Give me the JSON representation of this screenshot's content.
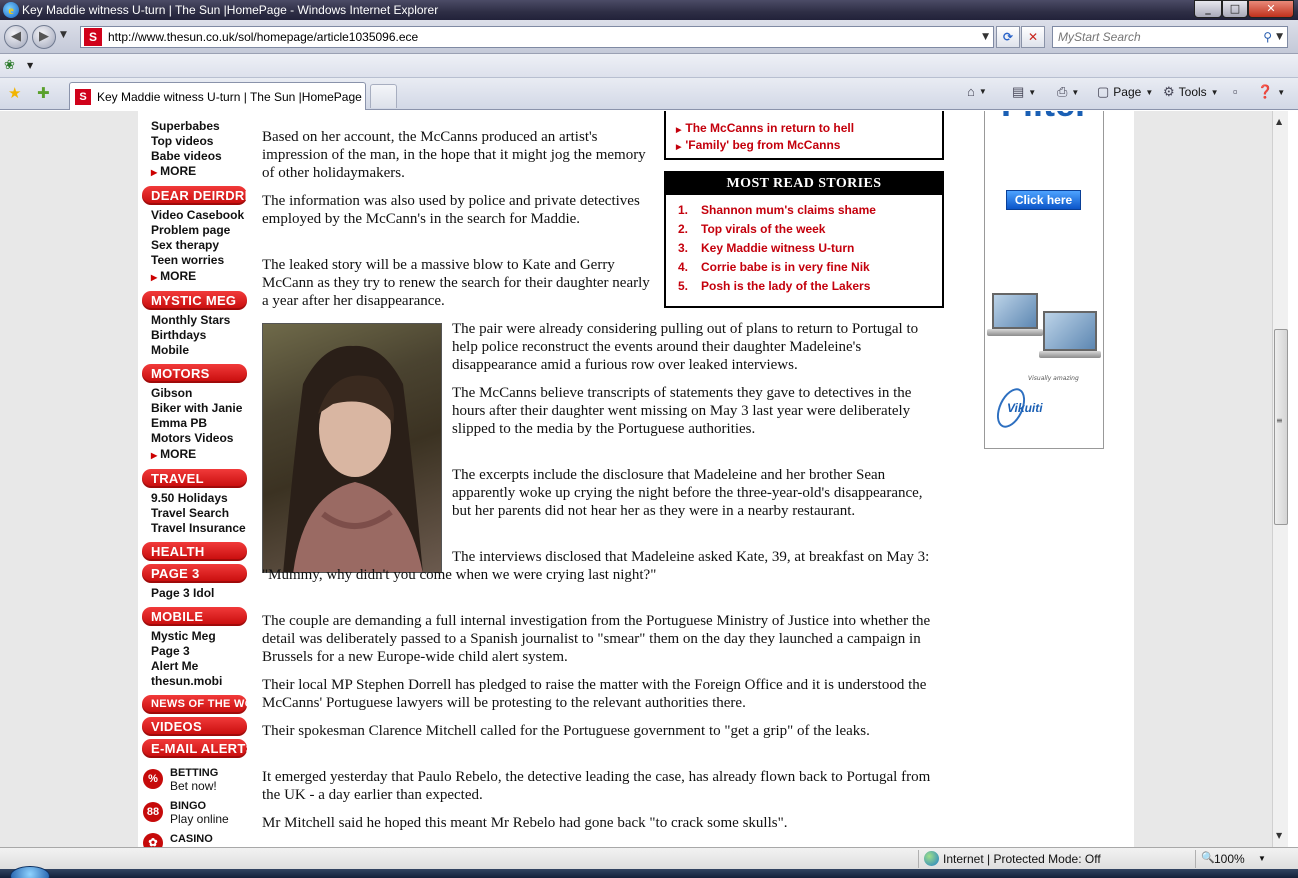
{
  "window": {
    "title": "Key Maddie witness U-turn | The Sun |HomePage - Windows Internet Explorer",
    "min_icon": "_",
    "max_icon": "□",
    "close_icon": "✕"
  },
  "browser": {
    "url": "http://www.thesun.co.uk/sol/homepage/article1035096.ece",
    "search_placeholder": "MyStart Search",
    "tab_label": "Key Maddie witness U-turn | The Sun |HomePage",
    "commands": {
      "page": "Page",
      "tools": "Tools"
    },
    "favicon_letter": "S",
    "colors": {
      "favicon_red": "#d0021b"
    }
  },
  "sidebar": {
    "groups": [
      {
        "header": "",
        "links": [
          "Superbabes",
          "Top videos",
          "Babe videos"
        ],
        "more": "MORE"
      },
      {
        "header": "DEAR DEIRDRE",
        "links": [
          "Video Casebook",
          "Problem page",
          "Sex therapy",
          "Teen worries"
        ],
        "more": "MORE"
      },
      {
        "header": "MYSTIC MEG",
        "links": [
          "Monthly Stars",
          "Birthdays",
          "Mobile"
        ],
        "more": ""
      },
      {
        "header": "MOTORS",
        "links": [
          "Gibson",
          "Biker with Janie",
          "Emma PB",
          "Motors Videos"
        ],
        "more": "MORE"
      },
      {
        "header": "TRAVEL",
        "links": [
          "9.50 Holidays",
          "Travel Search",
          "Travel Insurance"
        ],
        "more": ""
      },
      {
        "header": "HEALTH",
        "links": [],
        "more": ""
      },
      {
        "header": "PAGE 3",
        "links": [
          "Page 3 Idol"
        ],
        "more": ""
      },
      {
        "header": "MOBILE",
        "links": [
          "Mystic Meg",
          "Page 3",
          "Alert Me",
          "thesun.mobi"
        ],
        "more": ""
      },
      {
        "header": "NEWS OF THE WORLD",
        "links": [],
        "more": ""
      },
      {
        "header": "VIDEOS",
        "links": [],
        "more": ""
      },
      {
        "header": "E-MAIL ALERTS",
        "links": [],
        "more": ""
      }
    ],
    "promos": [
      {
        "icon": "%",
        "title": "BETTING",
        "sub": "Bet now!"
      },
      {
        "icon": "88",
        "title": "BINGO",
        "sub": "Play online"
      },
      {
        "icon": "✿",
        "title": "CASINO",
        "sub": ""
      }
    ]
  },
  "related": {
    "links": [
      "The McCanns in return to hell",
      "'Family' beg from McCanns"
    ]
  },
  "most_read": {
    "title": "MOST READ STORIES",
    "items": [
      {
        "num": "1.",
        "text": "Shannon mum's claims shame"
      },
      {
        "num": "2.",
        "text": "Top virals of the week"
      },
      {
        "num": "3.",
        "text": "Key Maddie witness U-turn"
      },
      {
        "num": "4.",
        "text": "Corrie babe is in very fine Nik"
      },
      {
        "num": "5.",
        "text": "Posh is the lady of the Lakers"
      }
    ]
  },
  "article": {
    "paragraphs": [
      "Based on her account, the McCanns produced an artist's impression of the man, in the hope that it might jog the memory of other holidaymakers.",
      "The information was also used by police and private detectives employed by the McCann's in the search for Maddie.",
      "The leaked story will be a massive blow to Kate and Gerry McCann as they try to renew the search for their daughter nearly a year after her disappearance.",
      "The pair were already considering pulling out of plans to return to Portugal to help police reconstruct the events around their daughter Madeleine's disappearance amid a furious row over leaked interviews.",
      "The McCanns believe transcripts of statements they gave to detectives in the hours after their daughter went missing on May 3 last year were deliberately slipped to the media by the Portuguese authorities.",
      "The excerpts include the disclosure that Madeleine and her brother Sean apparently woke up crying the night before the three-year-old's disappearance, but her parents did not hear her as they were in a nearby restaurant.",
      "The interviews disclosed that Madeleine asked Kate, 39, at breakfast on May 3: \"Mummy, why didn't you come when we were crying last night?\"",
      "The couple are demanding a full internal investigation from the Portuguese Ministry of Justice into whether the detail was deliberately passed to a Spanish journalist to \"smear\" them on the day they launched a campaign in Brussels for a new Europe-wide child alert system.",
      "Their local MP Stephen Dorrell has pledged to raise the matter with the Foreign Office and it is understood the McCanns' Portuguese lawyers will be protesting to the relevant authorities there.",
      "Their spokesman Clarence Mitchell called for the Portuguese government to \"get a grip\" of the leaks.",
      "It emerged yesterday that Paulo Rebelo, the detective leading the case, has already flown back to Portugal from the UK - a day earlier than expected.",
      "Mr Mitchell said he hoped this meant Mr Rebelo had gone back \"to crack some skulls\"."
    ]
  },
  "ad": {
    "brand": "Filter",
    "cta": "Click here",
    "tagline": "Visually amazing",
    "logo": "Vikuiti"
  },
  "statusbar": {
    "zone": "Internet | Protected Mode: Off",
    "zoom": "100%"
  }
}
